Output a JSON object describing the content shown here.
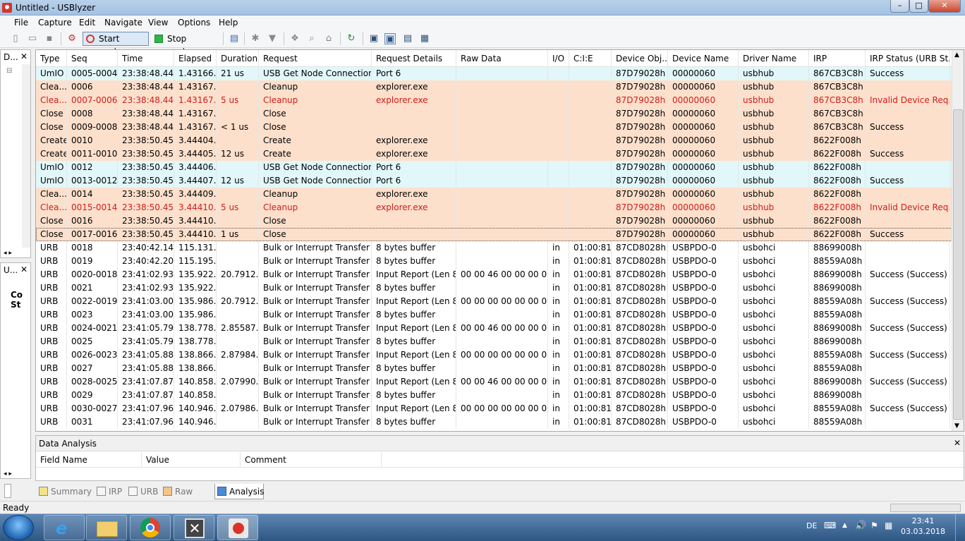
{
  "window": {
    "title": "Untitled - USBlyzer",
    "min": "–",
    "max": "□",
    "close": "✕"
  },
  "menu": [
    "File",
    "Capture",
    "Edit",
    "Navigate",
    "View",
    "Options",
    "Help"
  ],
  "toolbar": {
    "start_capture": "Start capture",
    "stop_capture": "Stop capture"
  },
  "left_panels": {
    "top_title": "D...",
    "bottom_title": "U...",
    "bottom_text1": "Co",
    "bottom_text2": "St"
  },
  "columns": [
    "Type",
    "Seq",
    "Time",
    "Elapsed",
    "Duration",
    "Request",
    "Request Details",
    "Raw Data",
    "I/O",
    "C:I:E",
    "Device Obj...",
    "Device Name",
    "Driver Name",
    "IRP",
    "IRP Status (URB St..."
  ],
  "rows": [
    {
      "kind": "usb",
      "c": [
        "UmIO",
        "0005-0004",
        "23:38:48.441",
        "1.43166...",
        "21 us",
        "USB Get Node Connection...",
        "Port 6",
        "",
        "",
        "",
        "87D79028h",
        "00000060",
        "usbhub",
        "867CB3C8h",
        "Success"
      ]
    },
    {
      "kind": "irp",
      "c": [
        "Clea...",
        "0006",
        "23:38:48.441",
        "1.43167...",
        "",
        "Cleanup",
        "explorer.exe",
        "",
        "",
        "",
        "87D79028h",
        "00000060",
        "usbhub",
        "867CB3C8h",
        ""
      ]
    },
    {
      "kind": "irp err",
      "c": [
        "Clea...",
        "0007-0006",
        "23:38:48.441",
        "1.43167...",
        "5 us",
        "Cleanup",
        "explorer.exe",
        "",
        "",
        "",
        "87D79028h",
        "00000060",
        "usbhub",
        "867CB3C8h",
        "Invalid Device Req..."
      ]
    },
    {
      "kind": "irp",
      "c": [
        "Close",
        "0008",
        "23:38:48.441",
        "1.43167...",
        "",
        "Close",
        "",
        "",
        "",
        "",
        "87D79028h",
        "00000060",
        "usbhub",
        "867CB3C8h",
        ""
      ]
    },
    {
      "kind": "irp",
      "c": [
        "Close",
        "0009-0008",
        "23:38:48.441",
        "1.43167...",
        "< 1 us",
        "Close",
        "",
        "",
        "",
        "",
        "87D79028h",
        "00000060",
        "usbhub",
        "867CB3C8h",
        "Success"
      ]
    },
    {
      "kind": "irp",
      "c": [
        "Create",
        "0010",
        "23:38:50.454",
        "3.44404...",
        "",
        "Create",
        "explorer.exe",
        "",
        "",
        "",
        "87D79028h",
        "00000060",
        "usbhub",
        "8622F008h",
        ""
      ]
    },
    {
      "kind": "irp",
      "c": [
        "Create",
        "0011-0010",
        "23:38:50.454",
        "3.44405...",
        "12 us",
        "Create",
        "explorer.exe",
        "",
        "",
        "",
        "87D79028h",
        "00000060",
        "usbhub",
        "8622F008h",
        "Success"
      ]
    },
    {
      "kind": "usb",
      "c": [
        "UmIO",
        "0012",
        "23:38:50.454",
        "3.44406...",
        "",
        "USB Get Node Connection...",
        "Port 6",
        "",
        "",
        "",
        "87D79028h",
        "00000060",
        "usbhub",
        "8622F008h",
        ""
      ]
    },
    {
      "kind": "usb",
      "c": [
        "UmIO",
        "0013-0012",
        "23:38:50.454",
        "3.44407...",
        "12 us",
        "USB Get Node Connection...",
        "Port 6",
        "",
        "",
        "",
        "87D79028h",
        "00000060",
        "usbhub",
        "8622F008h",
        "Success"
      ]
    },
    {
      "kind": "irp",
      "c": [
        "Clea...",
        "0014",
        "23:38:50.454",
        "3.44409...",
        "",
        "Cleanup",
        "explorer.exe",
        "",
        "",
        "",
        "87D79028h",
        "00000060",
        "usbhub",
        "8622F008h",
        ""
      ]
    },
    {
      "kind": "irp err",
      "c": [
        "Clea...",
        "0015-0014",
        "23:38:50.454",
        "3.44410...",
        "5 us",
        "Cleanup",
        "explorer.exe",
        "",
        "",
        "",
        "87D79028h",
        "00000060",
        "usbhub",
        "8622F008h",
        "Invalid Device Req..."
      ]
    },
    {
      "kind": "irp",
      "c": [
        "Close",
        "0016",
        "23:38:50.454",
        "3.44410...",
        "",
        "Close",
        "",
        "",
        "",
        "",
        "87D79028h",
        "00000060",
        "usbhub",
        "8622F008h",
        ""
      ]
    },
    {
      "kind": "irp sel",
      "c": [
        "Close",
        "0017-0016",
        "23:38:50.454",
        "3.44410...",
        "1 us",
        "Close",
        "",
        "",
        "",
        "",
        "87D79028h",
        "00000060",
        "usbhub",
        "8622F008h",
        "Success"
      ]
    },
    {
      "kind": "urb",
      "c": [
        "URB",
        "0018",
        "23:40:42.144",
        "115.131...",
        "",
        "Bulk or Interrupt Transfer",
        "8 bytes buffer",
        "",
        "in",
        "01:00:81",
        "87CD8028h",
        "USBPDO-0",
        "usbohci",
        "88699008h",
        ""
      ]
    },
    {
      "kind": "urb",
      "c": [
        "URB",
        "0019",
        "23:40:42.209",
        "115.195...",
        "",
        "Bulk or Interrupt Transfer",
        "8 bytes buffer",
        "",
        "in",
        "01:00:81",
        "87CD8028h",
        "USBPDO-0",
        "usbohci",
        "88559A08h",
        ""
      ]
    },
    {
      "kind": "urb",
      "c": [
        "URB",
        "0020-0018",
        "23:41:02.936",
        "135.922...",
        "20.7912...",
        "Bulk or Interrupt Transfer",
        "Input Report (Len 8)",
        "00 00 46 00 00 00 00 00",
        "in",
        "01:00:81",
        "87CD8028h",
        "USBPDO-0",
        "usbohci",
        "88699008h",
        "Success (Success)"
      ]
    },
    {
      "kind": "urb",
      "c": [
        "URB",
        "0021",
        "23:41:02.936",
        "135.922...",
        "",
        "Bulk or Interrupt Transfer",
        "8 bytes buffer",
        "",
        "in",
        "01:00:81",
        "87CD8028h",
        "USBPDO-0",
        "usbohci",
        "88699008h",
        ""
      ]
    },
    {
      "kind": "urb",
      "c": [
        "URB",
        "0022-0019",
        "23:41:03.000",
        "135.986...",
        "20.7912...",
        "Bulk or Interrupt Transfer",
        "Input Report (Len 8)",
        "00 00 00 00 00 00 00 00",
        "in",
        "01:00:81",
        "87CD8028h",
        "USBPDO-0",
        "usbohci",
        "88559A08h",
        "Success (Success)"
      ]
    },
    {
      "kind": "urb",
      "c": [
        "URB",
        "0023",
        "23:41:03.000",
        "135.986...",
        "",
        "Bulk or Interrupt Transfer",
        "8 bytes buffer",
        "",
        "in",
        "01:00:81",
        "87CD8028h",
        "USBPDO-0",
        "usbohci",
        "88559A08h",
        ""
      ]
    },
    {
      "kind": "urb",
      "c": [
        "URB",
        "0024-0021",
        "23:41:05.792",
        "138.778...",
        "2.85587...",
        "Bulk or Interrupt Transfer",
        "Input Report (Len 8)",
        "00 00 46 00 00 00 00 00",
        "in",
        "01:00:81",
        "87CD8028h",
        "USBPDO-0",
        "usbohci",
        "88699008h",
        "Success (Success)"
      ]
    },
    {
      "kind": "urb",
      "c": [
        "URB",
        "0025",
        "23:41:05.792",
        "138.778...",
        "",
        "Bulk or Interrupt Transfer",
        "8 bytes buffer",
        "",
        "in",
        "01:00:81",
        "87CD8028h",
        "USBPDO-0",
        "usbohci",
        "88699008h",
        ""
      ]
    },
    {
      "kind": "urb",
      "c": [
        "URB",
        "0026-0023",
        "23:41:05.880",
        "138.866...",
        "2.87984...",
        "Bulk or Interrupt Transfer",
        "Input Report (Len 8)",
        "00 00 00 00 00 00 00 00",
        "in",
        "01:00:81",
        "87CD8028h",
        "USBPDO-0",
        "usbohci",
        "88559A08h",
        "Success (Success)"
      ]
    },
    {
      "kind": "urb",
      "c": [
        "URB",
        "0027",
        "23:41:05.880",
        "138.866...",
        "",
        "Bulk or Interrupt Transfer",
        "8 bytes buffer",
        "",
        "in",
        "01:00:81",
        "87CD8028h",
        "USBPDO-0",
        "usbohci",
        "88559A08h",
        ""
      ]
    },
    {
      "kind": "urb",
      "c": [
        "URB",
        "0028-0025",
        "23:41:07.872",
        "140.858...",
        "2.07990...",
        "Bulk or Interrupt Transfer",
        "Input Report (Len 8)",
        "00 00 46 00 00 00 00 00",
        "in",
        "01:00:81",
        "87CD8028h",
        "USBPDO-0",
        "usbohci",
        "88699008h",
        "Success (Success)"
      ]
    },
    {
      "kind": "urb",
      "c": [
        "URB",
        "0029",
        "23:41:07.872",
        "140.858...",
        "",
        "Bulk or Interrupt Transfer",
        "8 bytes buffer",
        "",
        "in",
        "01:00:81",
        "87CD8028h",
        "USBPDO-0",
        "usbohci",
        "88699008h",
        ""
      ]
    },
    {
      "kind": "urb",
      "c": [
        "URB",
        "0030-0027",
        "23:41:07.960",
        "140.946...",
        "2.07986...",
        "Bulk or Interrupt Transfer",
        "Input Report (Len 8)",
        "00 00 00 00 00 00 00 00",
        "in",
        "01:00:81",
        "87CD8028h",
        "USBPDO-0",
        "usbohci",
        "88559A08h",
        "Success (Success)"
      ]
    },
    {
      "kind": "urb",
      "c": [
        "URB",
        "0031",
        "23:41:07.960",
        "140.946...",
        "",
        "Bulk or Interrupt Transfer",
        "8 bytes buffer",
        "",
        "in",
        "01:00:81",
        "87CD8028h",
        "USBPDO-0",
        "usbohci",
        "88559A08h",
        ""
      ]
    }
  ],
  "analysis": {
    "title": "Data Analysis",
    "columns": [
      "Field Name",
      "Value",
      "Comment"
    ]
  },
  "tabs": [
    "Summary",
    "IRP",
    "URB",
    "Raw Data",
    "Analysis"
  ],
  "status": "Ready",
  "tray": {
    "lang": "DE",
    "time": "23:41",
    "date": "03.03.2018"
  },
  "colors": {
    "usb_row": "#e1f7fa",
    "irp_row": "#fde0cc",
    "error_text": "#d01c1c"
  },
  "taskbar_apps": [
    "ie-icon",
    "explorer-folder-icon",
    "chrome-icon",
    "xming-icon",
    "usblyzer-icon"
  ]
}
